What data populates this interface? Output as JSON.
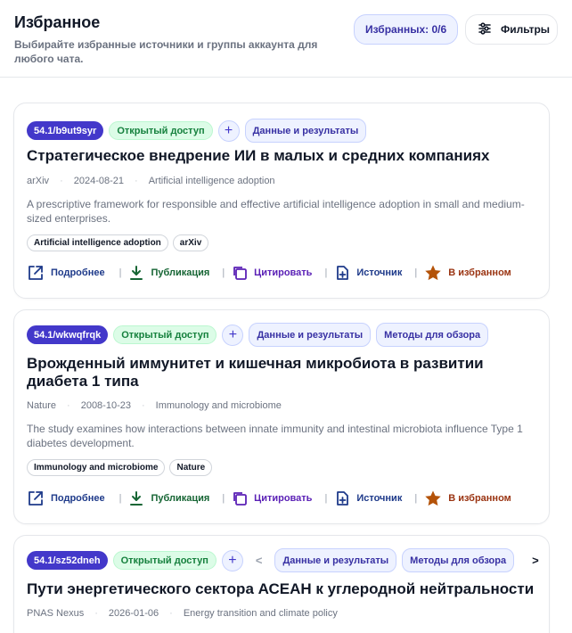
{
  "header": {
    "title": "Избранное",
    "subtitle": "Выбирайте избранные источники и группы аккаунта для любого чата.",
    "fav_count_label": "Избранных: 0/6",
    "filters_label": "Фильтры"
  },
  "actions_labels": {
    "more": "Подробнее",
    "publication": "Публикация",
    "cite": "Цитировать",
    "source": "Источник",
    "favorite": "В избранном",
    "separator": "|"
  },
  "colors": {
    "accent": "#4338ca",
    "open_access_bg": "#dcfce7",
    "open_access_text": "#15803d",
    "favorite": "#b45309"
  },
  "cards": [
    {
      "id": "54.1/b9ut9syr",
      "access": "Открытый доступ",
      "add": "+",
      "groups": [
        "Данные и результаты"
      ],
      "title": "Стратегическое внедрение ИИ в малых и средних компаниях",
      "source": "arXiv",
      "date": "2024-08-21",
      "topic": "Artificial intelligence adoption",
      "description": "A prescriptive framework for responsible and effective artificial intelligence adoption in small and medium-sized enterprises.",
      "tags": [
        "Artificial intelligence adoption",
        "arXiv"
      ]
    },
    {
      "id": "54.1/wkwqfrqk",
      "access": "Открытый доступ",
      "add": "+",
      "groups": [
        "Данные и результаты",
        "Методы для обзора"
      ],
      "title": "Врожденный иммунитет и кишечная микробиота в развитии диабета 1 типа",
      "source": "Nature",
      "date": "2008-10-23",
      "topic": "Immunology and microbiome",
      "description": "The study examines how interactions between innate immunity and intestinal microbiota influence Type 1 diabetes development.",
      "tags": [
        "Immunology and microbiome",
        "Nature"
      ]
    },
    {
      "id": "54.1/sz52dneh",
      "access": "Открытый доступ",
      "add": "+",
      "nav_prev": "<",
      "nav_next": ">",
      "groups": [
        "Данные и результаты",
        "Методы для обзора"
      ],
      "title": "Пути энергетического сектора АСЕАН к углеродной нейтральности",
      "source": "PNAS Nexus",
      "date": "2026-01-06",
      "topic": "Energy transition and climate policy"
    }
  ]
}
